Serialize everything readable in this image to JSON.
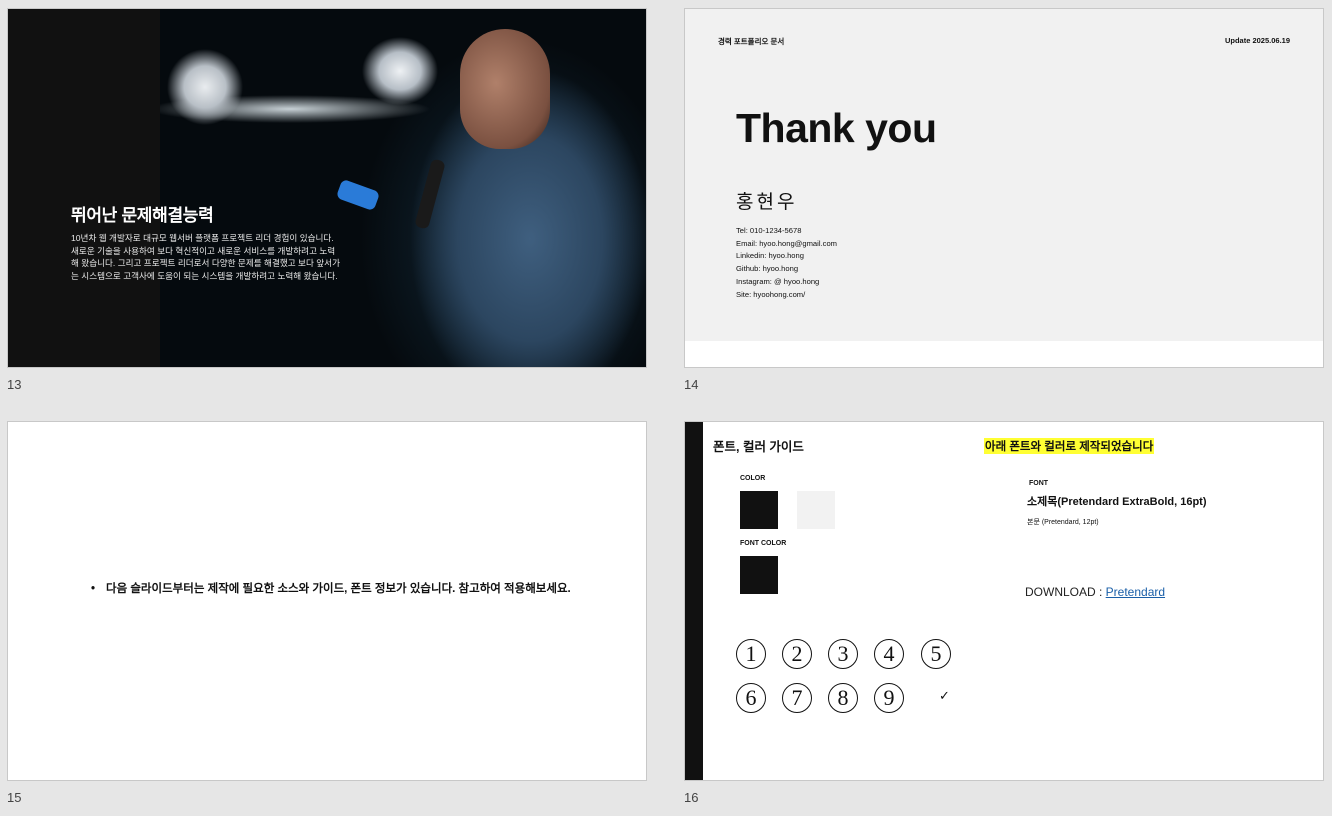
{
  "slides": [
    {
      "number": "13"
    },
    {
      "number": "14"
    },
    {
      "number": "15"
    },
    {
      "number": "16"
    }
  ],
  "s13": {
    "title": "뛰어난 문제해결능력",
    "body": "10년차 웹 개발자로 대규모 웹서버 플랫폼 프로젝트 리더 경험이 있습니다. 새로운 기술을 사용하여 보다 혁신적이고 새로운 서비스를 개발하려고 노력해 왔습니다. 그리고 프로젝트 리더로서 다양한 문제를 해결했고 보다 앞서가는 시스템으로 고객사에 도움이 되는 시스템을 개발하려고 노력해 왔습니다."
  },
  "s14": {
    "header_left": "경력 포트폴리오 문서",
    "header_right": "Update 2025.06.19",
    "title": "Thank you",
    "name": "홍현우",
    "contacts": [
      "Tel: 010-1234-5678",
      "Email: hyoo.hong@gmail.com",
      "Linkedin: hyoo.hong",
      "Github: hyoo.hong",
      "Instagram: @ hyoo.hong",
      "Site: hyoohong.com/"
    ]
  },
  "s15": {
    "bullet": "다음 슬라이드부터는 제작에  필요한 소스와 가이드, 폰트 정보가 있습니다. 참고하여 적용해보세요."
  },
  "s16": {
    "title": "폰트, 컬러 가이드",
    "highlight": "아래 폰트와 컬러로 제작되었습니다",
    "color_label": "COLOR",
    "font_color_label": "FONT COLOR",
    "font_label": "FONT",
    "font_title": "소제목(Pretendard ExtraBold, 16pt)",
    "font_body": "본문 (Pretendard, 12pt)",
    "download_label": "DOWNLOAD : ",
    "download_link": "Pretendard",
    "colors": [
      "#111111",
      "#f2f2f2"
    ],
    "font_color": "#111111",
    "circles": [
      "1",
      "2",
      "3",
      "4",
      "5",
      "6",
      "7",
      "8",
      "9"
    ],
    "check": "✓"
  }
}
